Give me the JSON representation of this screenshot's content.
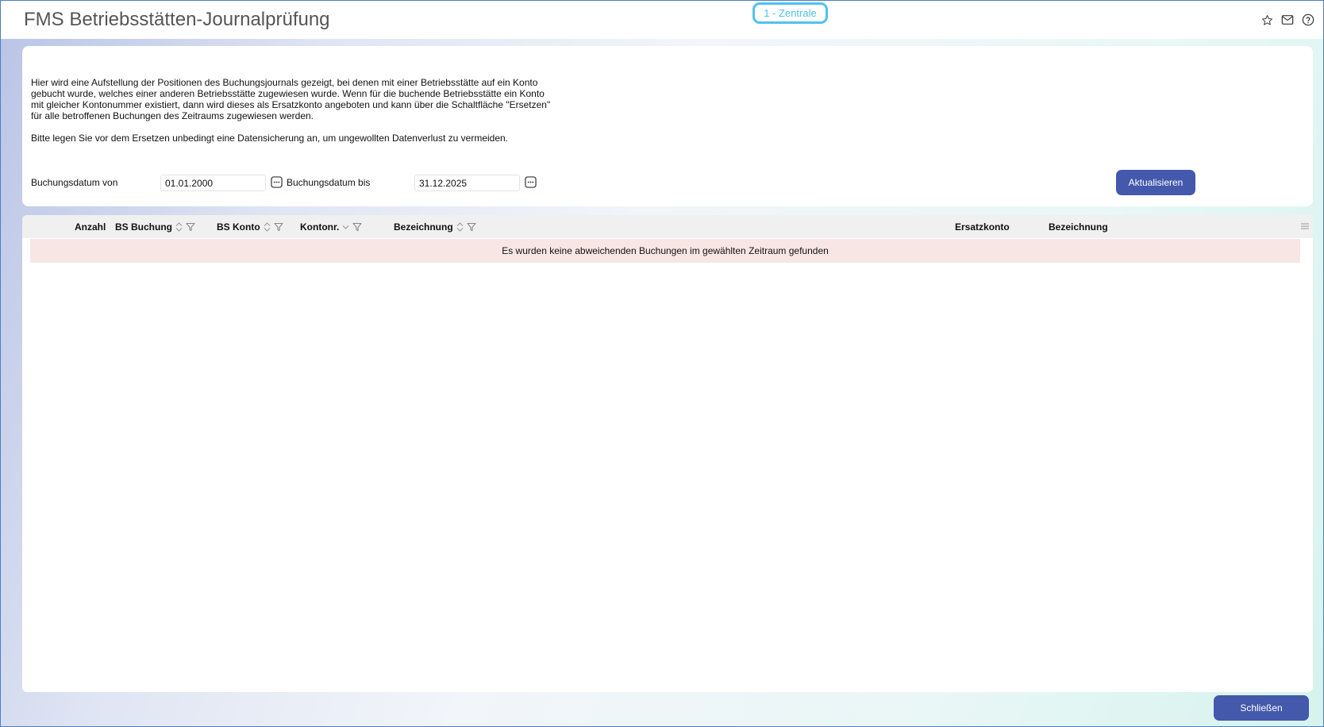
{
  "window": {
    "title": "FMS Betriebsstätten-Journalprüfung",
    "location_badge": "1 - Zentrale",
    "icons": [
      "star-icon",
      "mail-icon",
      "help-icon"
    ]
  },
  "intro": {
    "text": "Hier wird eine Aufstellung der Positionen des Buchungsjournals gezeigt, bei denen mit einer Betriebsstätte auf ein Konto gebucht wurde, welches einer anderen Betriebsstätte zugewiesen wurde. Wenn für die buchende Betriebsstätte ein Konto mit gleicher Kontonummer existiert, dann wird dieses als Ersatzkonto angeboten und kann über die Schaltfläche \"Ersetzen\" für alle betroffenen Buchungen des Zeitraums zugewiesen werden.",
    "note": "Bitte legen Sie vor dem Ersetzen unbedingt eine Datensicherung an, um ungewollten Datenverlust zu vermeiden."
  },
  "filter": {
    "from_label": "Buchungsdatum von",
    "from_value": "01.01.2000",
    "to_label": "Buchungsdatum bis",
    "to_value": "31.12.2025",
    "refresh_label": "Aktualisieren"
  },
  "table": {
    "columns": [
      {
        "label": "Anzahl"
      },
      {
        "label": "BS Buchung"
      },
      {
        "label": "BS Konto"
      },
      {
        "label": "Kontonr."
      },
      {
        "label": "Bezeichnung"
      },
      {
        "label": "Ersatzkonto"
      },
      {
        "label": "Bezeichnung"
      }
    ],
    "empty_message": "Es wurden keine abweichenden Buchungen im gewählten Zeitraum gefunden"
  },
  "footer": {
    "close_label": "Schließen"
  },
  "colors": {
    "accent": "#4458ac",
    "badge": "#4ec2ef",
    "empty_row": "#f7e6e4"
  }
}
